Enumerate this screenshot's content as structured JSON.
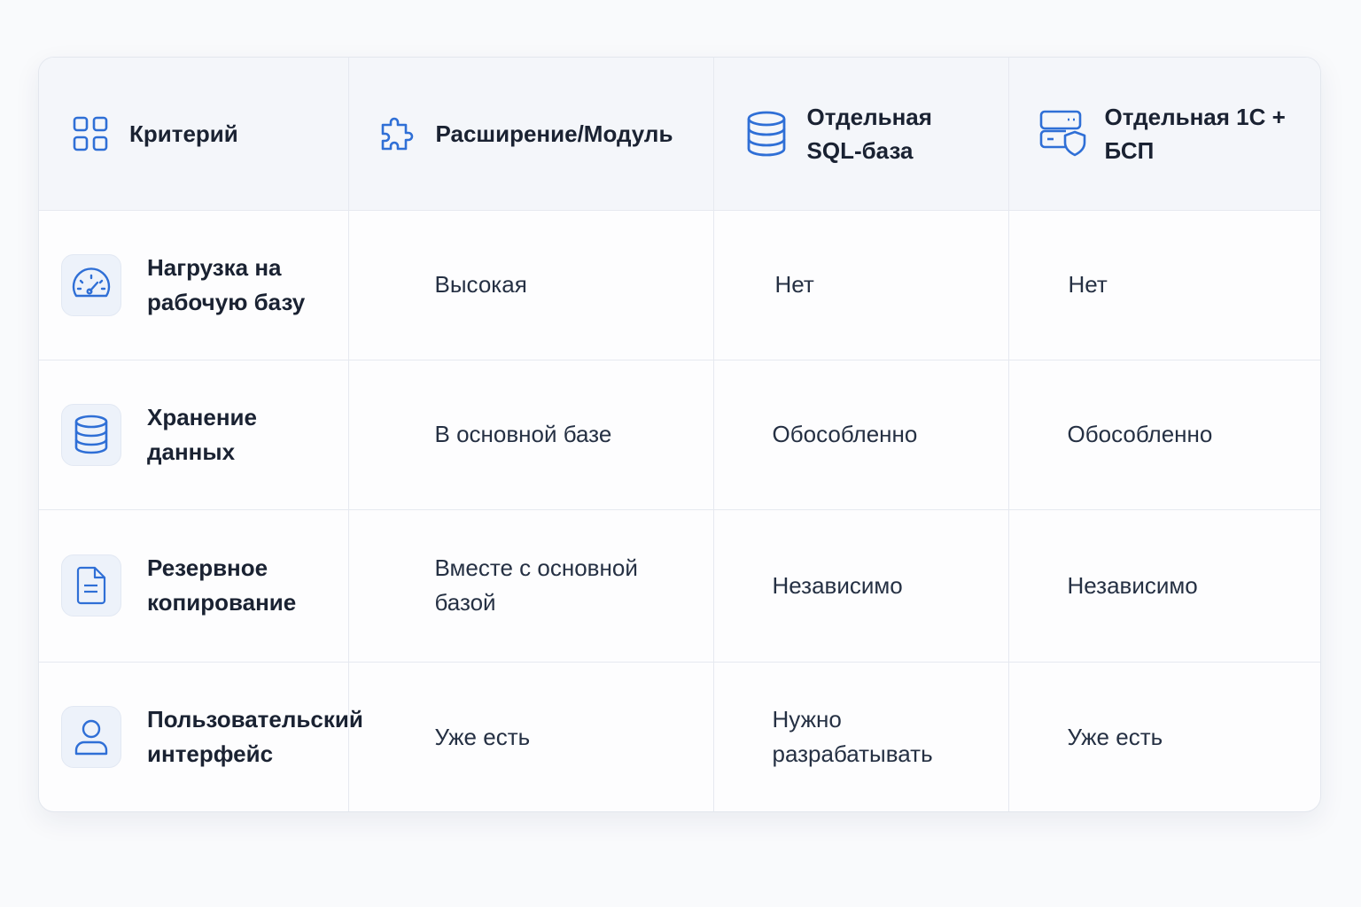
{
  "table": {
    "headers": [
      {
        "label": "Критерий",
        "icon": "grid-icon"
      },
      {
        "label": "Расширение/Модуль",
        "icon": "puzzle-icon"
      },
      {
        "label": "Отдельная SQL-база",
        "icon": "database-icon"
      },
      {
        "label": "Отдельная 1С + БСП",
        "icon": "server-shield-icon"
      }
    ],
    "rows": [
      {
        "criterion": "Нагрузка на рабочую базу",
        "icon": "speedometer-icon",
        "values": [
          "Высокая",
          "Нет",
          "Нет"
        ]
      },
      {
        "criterion": "Хранение данных",
        "icon": "database-icon",
        "values": [
          "В основной базе",
          "Обособленно",
          "Обособленно"
        ]
      },
      {
        "criterion": "Резервное копирование",
        "icon": "document-icon",
        "values": [
          "Вместе с основной базой",
          "Независимо",
          "Независимо"
        ]
      },
      {
        "criterion": "Пользовательский интерфейс",
        "icon": "user-icon",
        "values": [
          "Уже есть",
          "Нужно разрабатывать",
          "Уже есть"
        ]
      }
    ]
  },
  "colors": {
    "accent": "#2f6fd6",
    "header_bg": "#f4f6fa",
    "icon_tile_bg": "#edf2fa",
    "text": "#1a2232",
    "border": "#e6e9f0"
  }
}
